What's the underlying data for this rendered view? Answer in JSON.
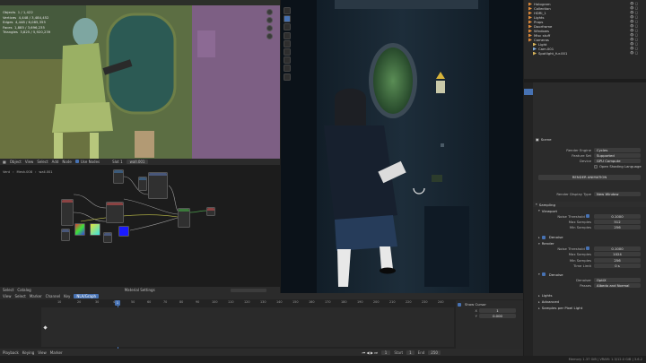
{
  "viewport_left": {
    "stats": [
      {
        "label": "Objects",
        "value": "1 / 1,422"
      },
      {
        "label": "Vertices",
        "value": "4,448 / 3,484,452"
      },
      {
        "label": "Edges",
        "value": "4,448 / 6,085,355"
      },
      {
        "label": "Faces",
        "value": "1,885 / 3,696,235"
      },
      {
        "label": "Triangles",
        "value": "3,825 / 5,920,239"
      }
    ]
  },
  "node_editor": {
    "header": {
      "mode": "Object",
      "menus": [
        "View",
        "Select",
        "Add",
        "Node"
      ],
      "use_nodes": "Use Nodes",
      "slot": "Slot 1",
      "material": "wall.001"
    },
    "breadcrumb": [
      "Vent",
      "Mesh.008",
      "wall.001"
    ],
    "status_menus": [
      "Select",
      "Catalog"
    ],
    "material_settings": "Material Settings",
    "node_labels": {
      "material_output": "Material Output"
    }
  },
  "timeline": {
    "menus": [
      "View",
      "Select",
      "Marker",
      "Channel",
      "Key"
    ],
    "mode": "NLA/Graph",
    "frames": [
      "10",
      "20",
      "30",
      "40",
      "50",
      "60",
      "70",
      "80",
      "90",
      "100",
      "110",
      "120",
      "130",
      "140",
      "150",
      "160",
      "170",
      "180",
      "190",
      "200",
      "210",
      "220",
      "230",
      "240",
      "250"
    ],
    "current_frame": "1",
    "playback": "Playback",
    "keying": "Keying",
    "view": "View",
    "marker": "Marker",
    "show_cursor": "Show Cursor",
    "cursor_x": "1",
    "cursor_y": "0.000",
    "start_label": "Start",
    "end_label": "End",
    "start": "1",
    "end": "250"
  },
  "outliner": {
    "items": [
      "Hologram",
      "Collection",
      "HDRI_1",
      "Lights",
      "Props",
      "Doorframe",
      "Windows",
      "Misc stuff",
      "Cameras",
      "Light",
      "Cam.001",
      "Spotlight_fur.001"
    ]
  },
  "properties": {
    "title": "Scene",
    "render_engine": {
      "label": "Render Engine",
      "value": "Cycles"
    },
    "feature_set": {
      "label": "Feature Set",
      "value": "Supported"
    },
    "device": {
      "label": "Device",
      "value": "GPU Compute"
    },
    "osl": "Open Shading Language",
    "render_animation": "RENDER ANIMATION",
    "display_type": {
      "label": "Render Display Type",
      "value": "New Window"
    },
    "sampling": "Sampling",
    "viewport": "Viewport",
    "vp_noise": {
      "label": "Noise Threshold",
      "value": "0.1000"
    },
    "vp_max": {
      "label": "Max Samples",
      "value": "512"
    },
    "vp_min": {
      "label": "Min Samples",
      "value": "256"
    },
    "denoise_vp": "Denoise",
    "render": "Render",
    "r_noise": {
      "label": "Noise Threshold",
      "value": "0.1000"
    },
    "r_max": {
      "label": "Max Samples",
      "value": "1024"
    },
    "r_min": {
      "label": "Min Samples",
      "value": "256"
    },
    "time_limit": {
      "label": "Time Limit",
      "value": "0 s"
    },
    "denoise_r": "Denoise",
    "denoiser": {
      "label": "Denoiser",
      "value": "OptiX"
    },
    "passes": {
      "label": "Passes",
      "value": "Albedo and Normal"
    },
    "lights": "Lights",
    "advanced": "Advanced",
    "samples_per_pixel": "Samples per Pixel Light"
  },
  "statusbar": {
    "text": "Memory 1.37 GiB | VRAM: 1.3/12.0 GiB | 3.6.2"
  },
  "colors": {
    "accent": "#4772b3",
    "frame": "#4772b3",
    "orange": "#e08b3b"
  }
}
